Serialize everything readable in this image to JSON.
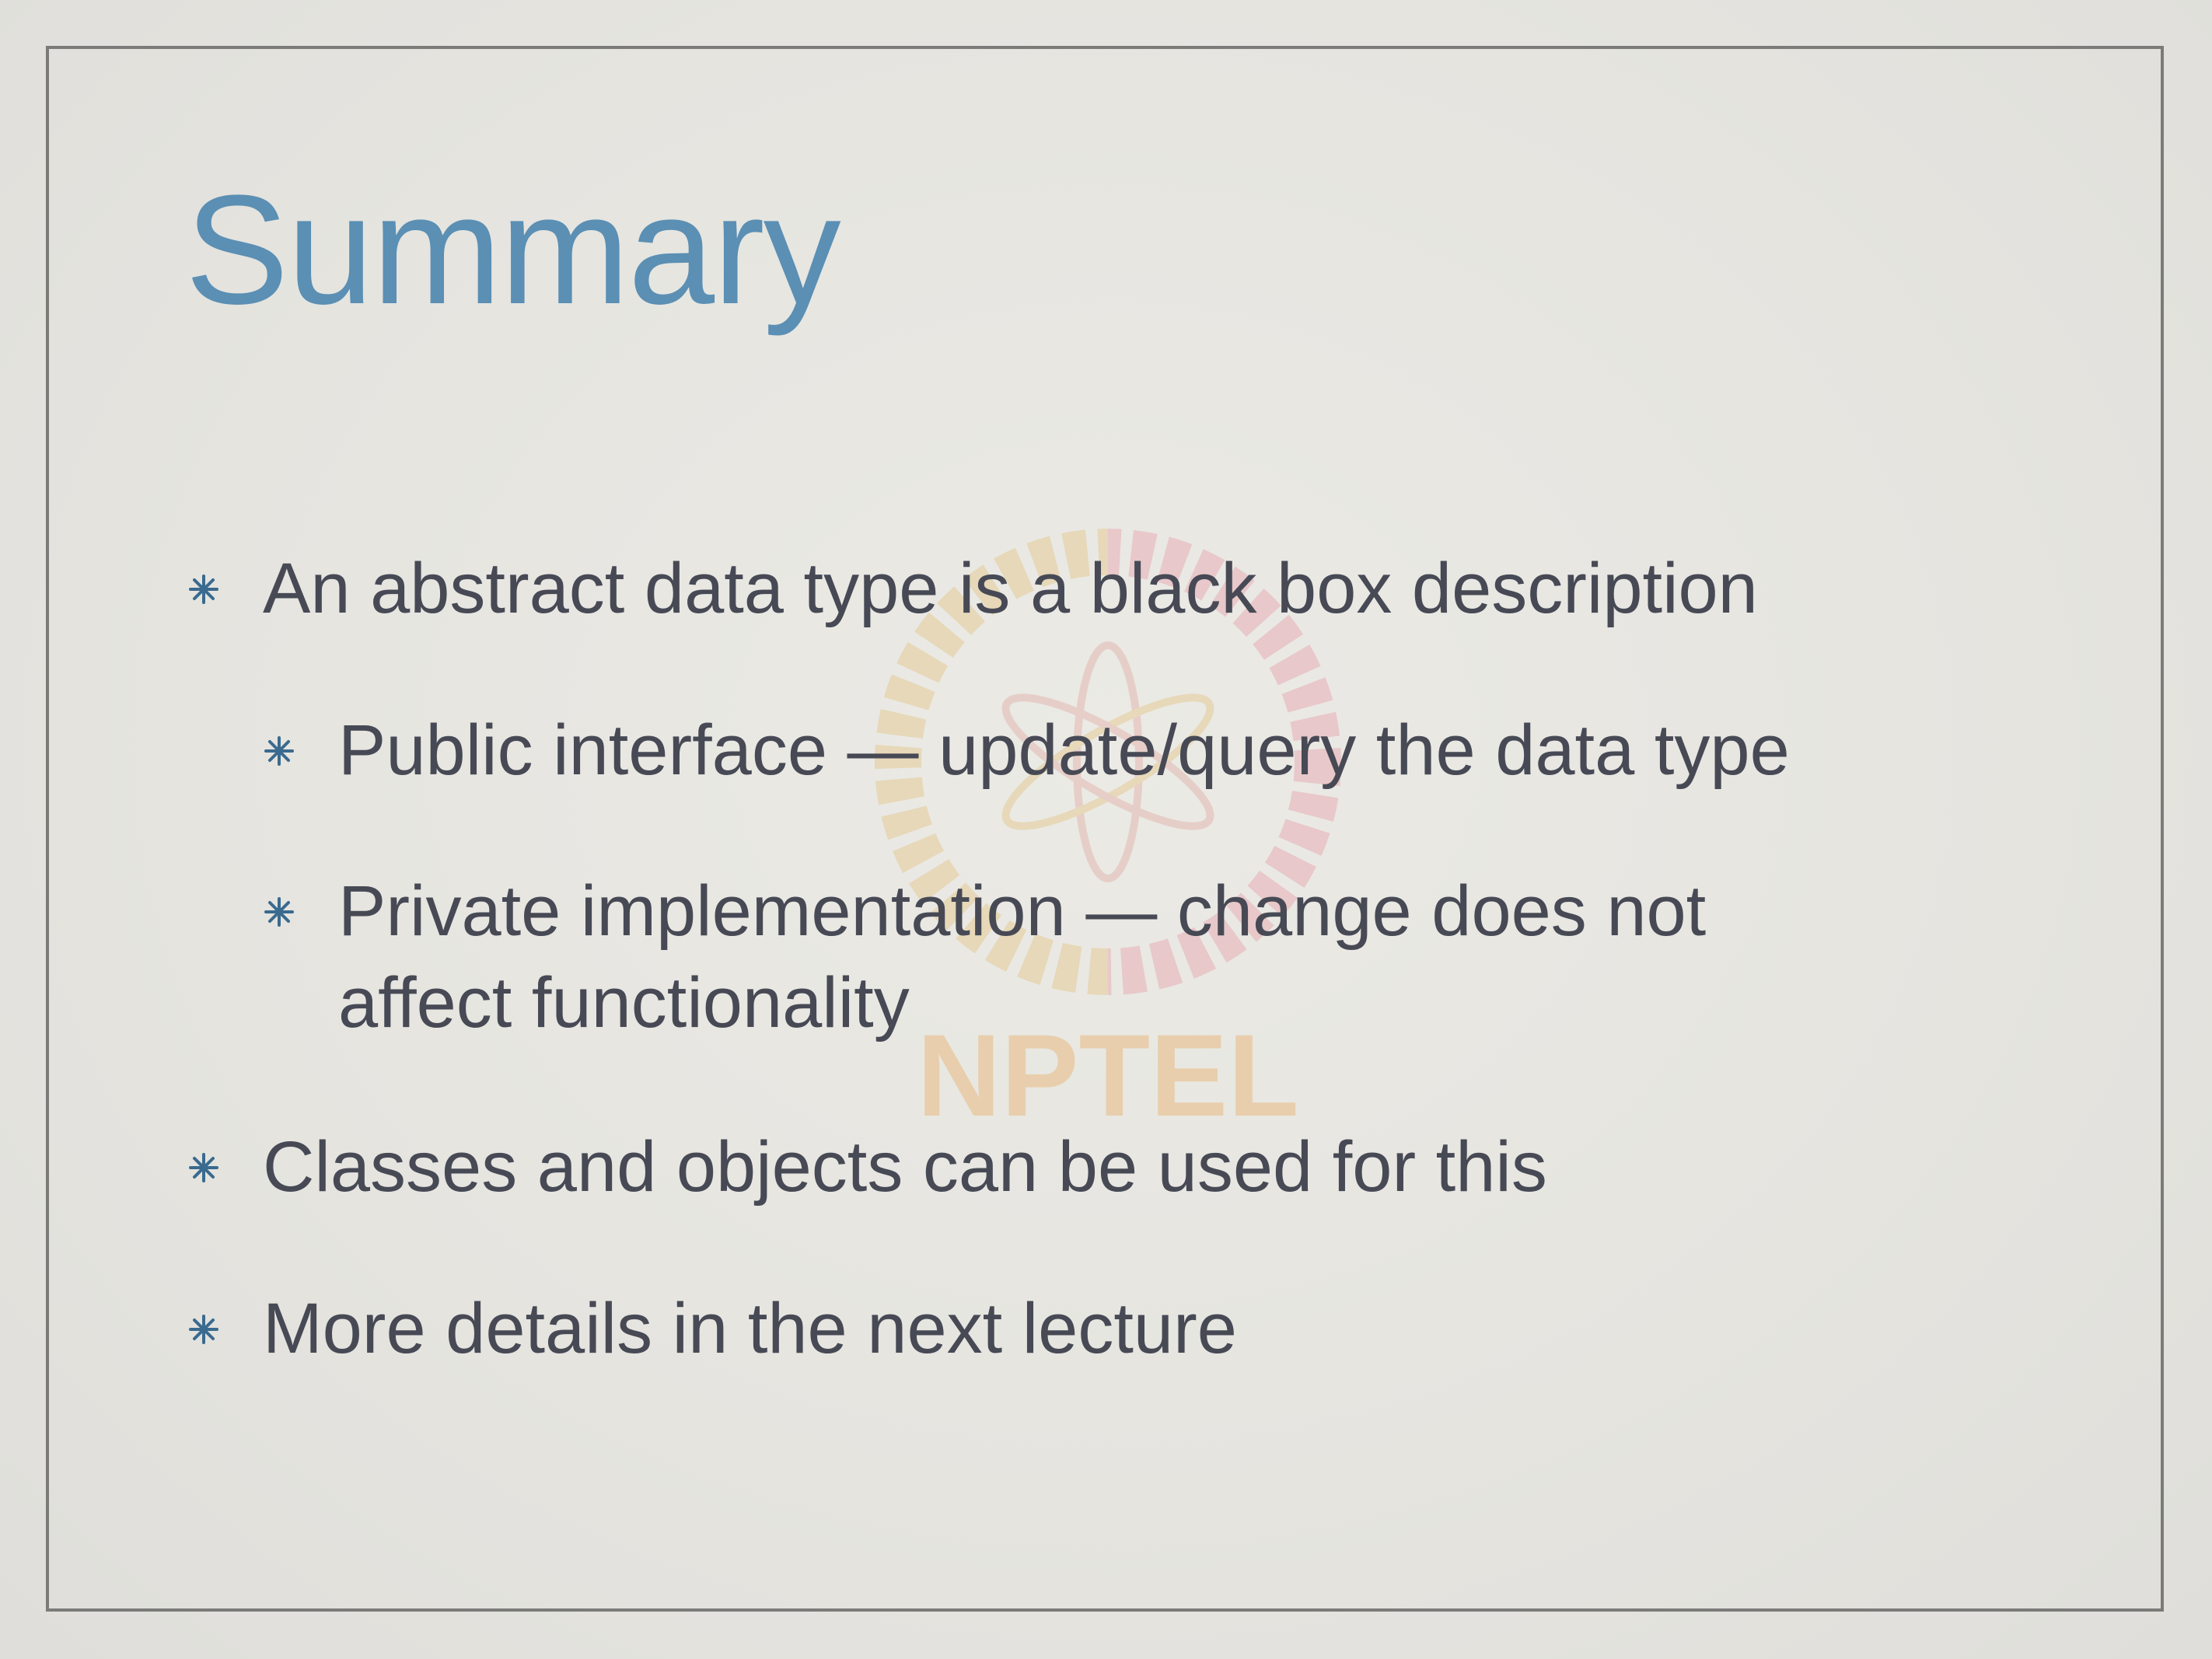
{
  "slide": {
    "title": "Summary",
    "watermark_text": "NPTEL",
    "bullets": [
      {
        "level": 1,
        "text": "An abstract data type is a black box description"
      },
      {
        "level": 2,
        "text": "Public interface — update/query the data type"
      },
      {
        "level": 2,
        "text_line1": "Private implementation — change does not",
        "text_line2": "affect functionality"
      },
      {
        "level": 1,
        "text": "Classes and objects can be used for this"
      },
      {
        "level": 1,
        "text": "More details in the next lecture"
      }
    ]
  },
  "icons": {
    "bullet": "asterisk-bullet-icon",
    "watermark": "nptel-logo-icon"
  },
  "colors": {
    "title": "#5b8fb4",
    "body_text": "#474a55",
    "bullet": "#3a6a8f",
    "frame": "#7b7b79"
  }
}
